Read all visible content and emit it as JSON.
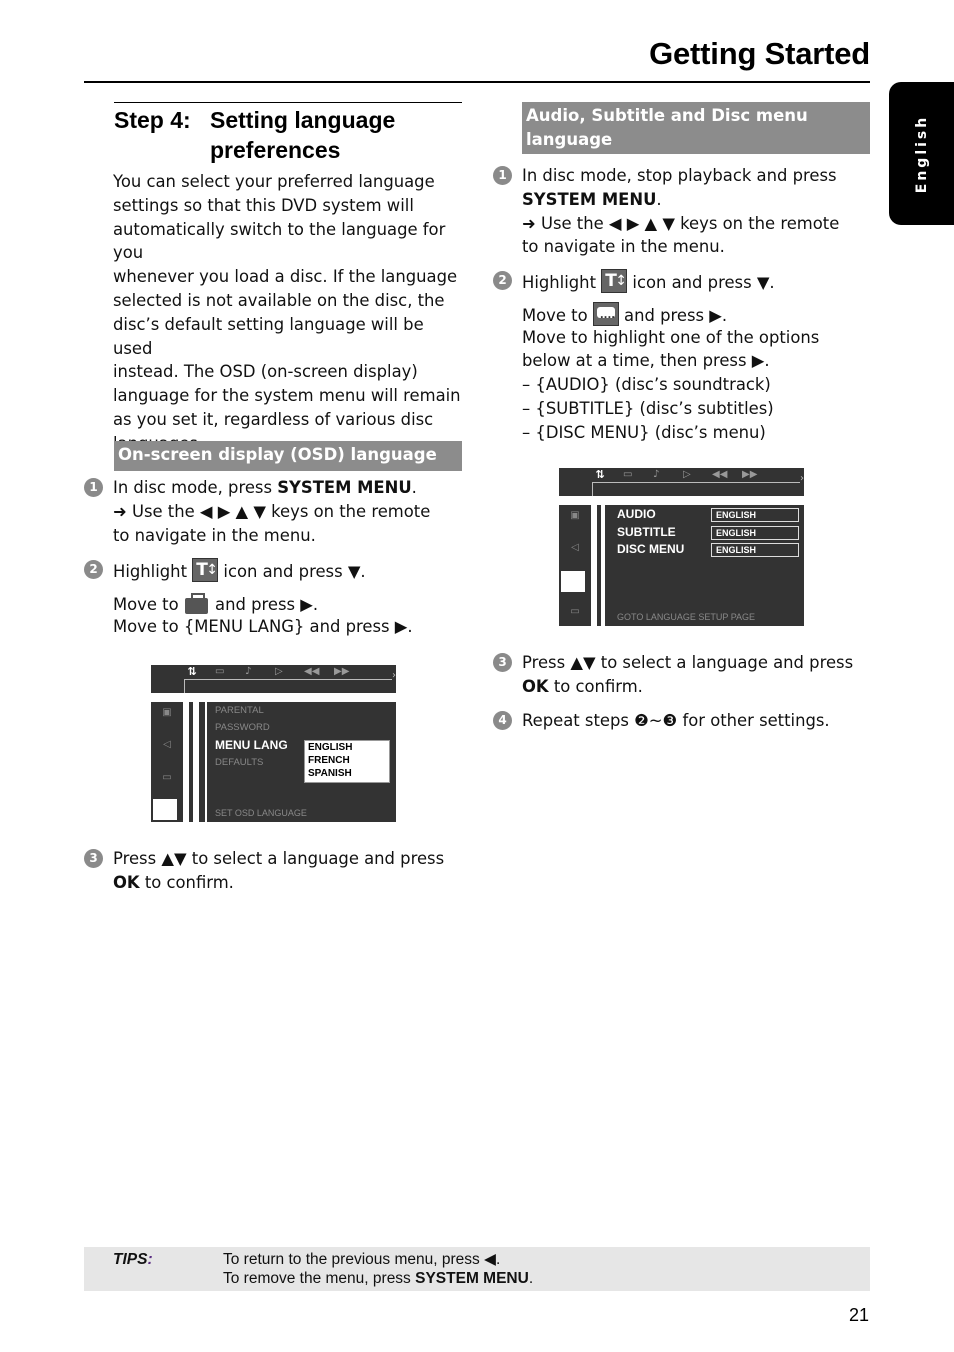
{
  "header": {
    "title": "Getting Started",
    "side_tab": "English"
  },
  "left": {
    "step_number": "Step 4:",
    "step_title_line1": "Setting language",
    "step_title_line2": "preferences",
    "intro_lines": [
      "You can select your preferred language",
      "settings so that this DVD system will",
      "automatically switch to the language for you",
      "whenever you load a disc.  If the language",
      "selected is not available on the disc, the",
      "disc’s default setting language will be used",
      "instead.  The OSD (on-screen display)",
      "language for the system menu will remain",
      "as you set it, regardless of various disc",
      "languages."
    ],
    "section_title": "On-screen display (OSD) language",
    "steps": [
      {
        "num": "1",
        "l1a": "In disc mode, press ",
        "l1b": "SYSTEM MENU",
        "l1c": ".",
        "l2": "➜ Use the ◀ ▶ ▲ ▼ keys on the remote",
        "l3": "to navigate in the menu."
      },
      {
        "num": "2",
        "l1a": "Highlight ",
        "l1b": " icon and press ▼.",
        "l2a": "Move to ",
        "l2b": " and press ▶.",
        "l3": "Move to {MENU LANG} and press ▶."
      },
      {
        "num": "3",
        "l1": "Press ▲▼ to select a language and press",
        "l2a": "OK",
        "l2b": " to confirm."
      }
    ],
    "osd": {
      "menu_items": [
        "PARENTAL",
        "PASSWORD",
        "MENU LANG",
        "DEFAULTS"
      ],
      "active_item": "MENU LANG",
      "options": [
        "ENGLISH",
        "FRENCH",
        "SPANISH"
      ],
      "footer": "SET OSD LANGUAGE"
    }
  },
  "right": {
    "section_title_line1": "Audio, Subtitle and Disc menu",
    "section_title_line2": "language",
    "steps": [
      {
        "num": "1",
        "l1": "In disc mode, stop playback and press",
        "l2a": "SYSTEM MENU",
        "l2b": ".",
        "l3": "➜ Use the ◀ ▶ ▲ ▼ keys on the remote",
        "l4": "to navigate in the menu."
      },
      {
        "num": "2",
        "l1a": "Highlight ",
        "l1b": " icon and press ▼.",
        "l2a": "Move to ",
        "l2b": " and press ▶.",
        "l3": "Move to highlight one of the options",
        "l4": "below at a time, then press ▶.",
        "opts": [
          "–   {AUDIO} (disc’s soundtrack)",
          "–   {SUBTITLE} (disc’s subtitles)",
          "–   {DISC MENU} (disc’s menu)"
        ]
      },
      {
        "num": "3",
        "l1": "Press ▲▼ to select a language and press",
        "l2a": "OK",
        "l2b": " to confirm."
      },
      {
        "num": "4",
        "l1": "Repeat steps ❷~❸ for other settings."
      }
    ],
    "osd": {
      "labels": [
        "AUDIO",
        "SUBTITLE",
        "DISC MENU"
      ],
      "values": [
        "ENGLISH",
        "ENGLISH",
        "ENGLISH"
      ],
      "footer": "GOTO LANGUAGE SETUP PAGE"
    }
  },
  "tips": {
    "label": "TIPS",
    "colon": ":",
    "line1": "To return to the previous menu, press ◀.",
    "line2a": "To remove the menu, press ",
    "line2b": "SYSTEM MENU",
    "line2c": "."
  },
  "footer": {
    "page_number": "21"
  }
}
